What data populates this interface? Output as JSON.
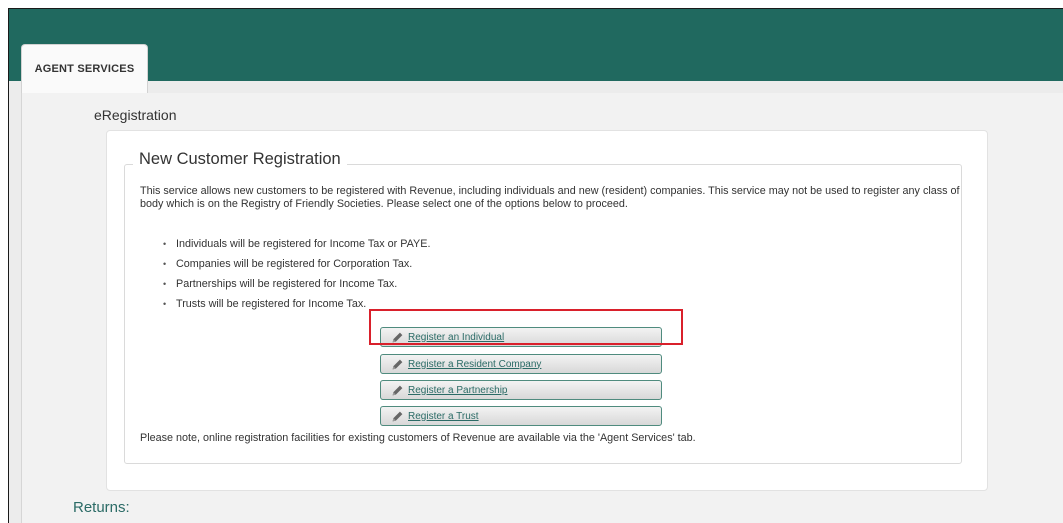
{
  "tab": {
    "label": "AGENT SERVICES"
  },
  "section": {
    "title": "eRegistration"
  },
  "registration": {
    "heading": "New Customer Registration",
    "intro": "This service allows new customers to be registered with Revenue, including individuals and new (resident) companies. This service may not be used to register any class of body which is on the Registry of Friendly Societies. Please select one of the options below to proceed.",
    "bullets": [
      "Individuals will be registered for Income Tax or PAYE.",
      "Companies will be registered for Corporation Tax.",
      "Partnerships will be registered for Income Tax.",
      "Trusts will be registered for Income Tax."
    ],
    "buttons": [
      "Register an Individual",
      "Register a Resident Company",
      "Register a Partnership",
      "Register a Trust"
    ],
    "note": "Please note, online registration facilities for existing customers of Revenue are available via the 'Agent Services' tab."
  },
  "below": {
    "partial_link": "Returns:"
  },
  "icons": {
    "button_icon": "pencil-icon"
  },
  "colors": {
    "header": "#20695f",
    "link": "#2b6b66",
    "highlight": "#d9202b",
    "button_border": "#4f8b7e"
  }
}
